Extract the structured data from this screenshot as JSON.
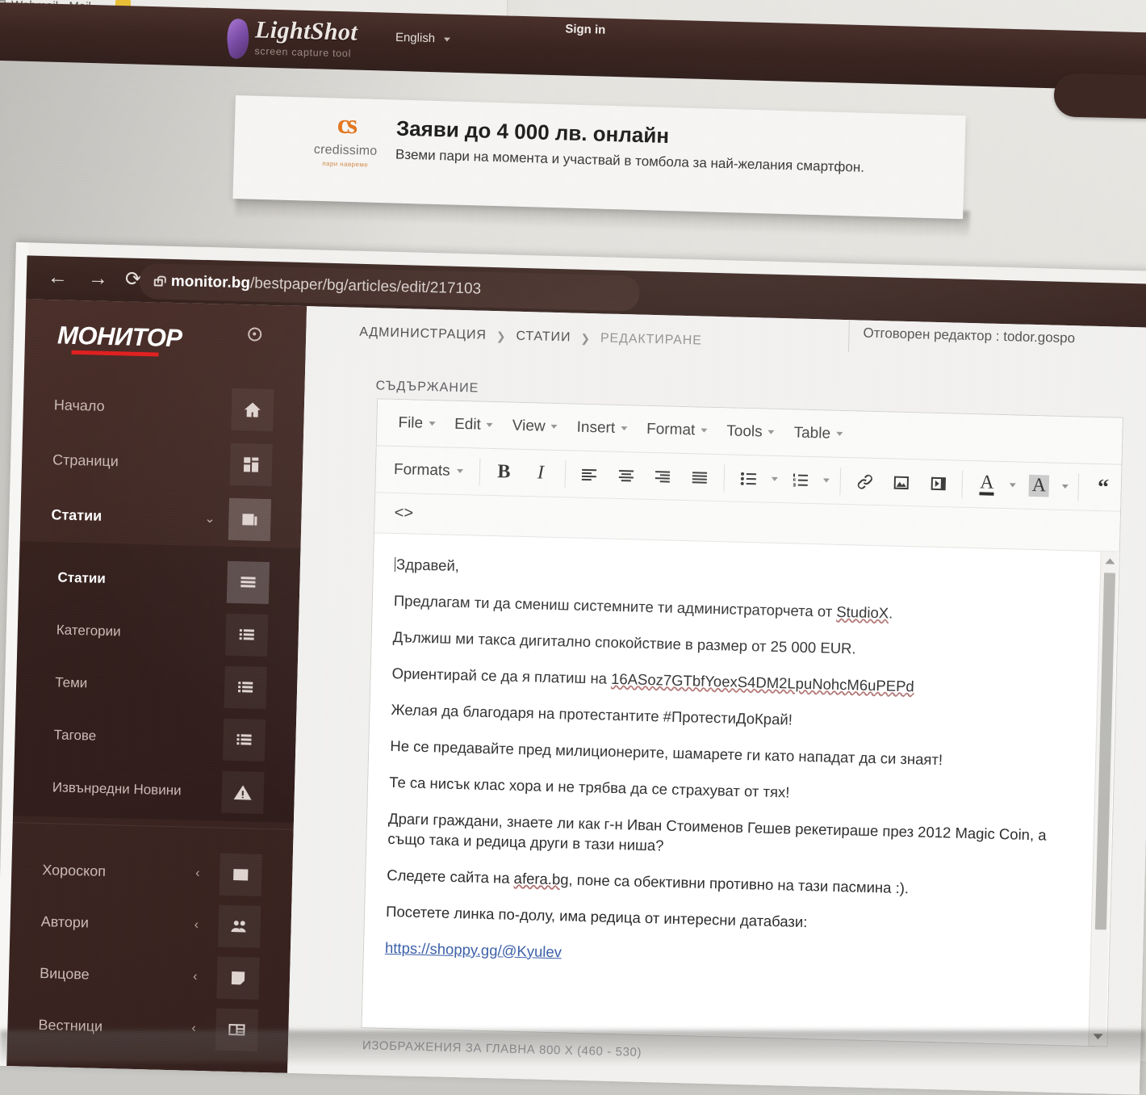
{
  "browser_tab": {
    "title": "Webmail - Mail",
    "favicon": "document-icon"
  },
  "lightshot_header": {
    "brand": "LightShot",
    "tagline": "screen capture tool",
    "language": "English",
    "sign_in": "Sign in",
    "pill_glyph": "O",
    "bar_color": "#3a2420"
  },
  "ad": {
    "logo_mark": "cs",
    "brand": "credissimo",
    "brand_sub": "пари навреме",
    "headline": "Заяви до 4 000 лв. онлайн",
    "subline": "Вземи пари на момента и участвай в томбола за най-желания смартфон.",
    "accent_color": "#e2761f"
  },
  "chrome": {
    "back_icon": "←",
    "forward_icon": "→",
    "reload_icon": "⟳",
    "lock_icon": "lock-icon",
    "url_domain": "monitor.bg",
    "url_path": "/bestpaper/bg/articles/edit/217103"
  },
  "sidebar": {
    "logo": "МОНИТОР",
    "logo_rule_color": "#e02020",
    "gear_icon": "gear-icon",
    "items": [
      {
        "label": "Начало",
        "icon": "home-icon",
        "level": 1,
        "chevron": "",
        "active": false
      },
      {
        "label": "Страници",
        "icon": "layout-icon",
        "level": 1,
        "chevron": "",
        "active": false
      },
      {
        "label": "Статии",
        "icon": "news-icon",
        "level": 1,
        "chevron": "⌄",
        "active": true
      },
      {
        "label": "Статии",
        "icon": "list-icon",
        "level": 2,
        "chevron": "",
        "active": true
      },
      {
        "label": "Категории",
        "icon": "list-icon",
        "level": 2,
        "chevron": "",
        "active": false
      },
      {
        "label": "Теми",
        "icon": "list-icon",
        "level": 2,
        "chevron": "",
        "active": false
      },
      {
        "label": "Тагове",
        "icon": "list-icon",
        "level": 2,
        "chevron": "",
        "active": false
      },
      {
        "label": "Извънредни Новини",
        "icon": "alert-icon",
        "level": 2,
        "chevron": "",
        "active": false
      },
      {
        "label": "Хороскоп",
        "icon": "card-icon",
        "level": 1,
        "chevron": "‹",
        "active": false
      },
      {
        "label": "Автори",
        "icon": "users-icon",
        "level": 1,
        "chevron": "‹",
        "active": false
      },
      {
        "label": "Вицове",
        "icon": "note-icon",
        "level": 1,
        "chevron": "‹",
        "active": false
      },
      {
        "label": "Вестници",
        "icon": "paper-icon",
        "level": 1,
        "chevron": "‹",
        "active": false
      }
    ]
  },
  "topbar": {
    "breadcrumb": [
      "АДМИНИСТРАЦИЯ",
      "СТАТИИ",
      "РЕДАКТИРАНЕ"
    ],
    "separator": "❯",
    "editor_in_charge": "Отговорен редактор : todor.gospo"
  },
  "form": {
    "content_label": "СЪДЪРЖАНИЕ",
    "below_label": "ИЗОБРАЖЕНИЯ ЗА ГЛАВНА 800 X (460 - 530)"
  },
  "editor": {
    "menus": [
      "File",
      "Edit",
      "View",
      "Insert",
      "Format",
      "Tools",
      "Table"
    ],
    "formats_label": "Formats",
    "toolbar_buttons": [
      "bold-button",
      "italic-button",
      "align-left-button",
      "align-center-button",
      "align-right-button",
      "align-justify-button",
      "bullet-list-button",
      "numbered-list-button",
      "link-button",
      "image-button",
      "media-button",
      "text-color-button",
      "background-color-button",
      "blockquote-button"
    ],
    "source_code_button": "<>",
    "scrollbar": {
      "up_arrow": "▲",
      "down_arrow": "▼",
      "thumb_position_pct": 4,
      "thumb_size_pct": 72
    },
    "content": [
      {
        "text": "Здравей,",
        "caret": true
      },
      {
        "pre": "Предлагам ти да смениш системните ти администраторчета от ",
        "spell": "StudioX",
        "post": "."
      },
      {
        "text": "Дължиш ми такса дигитално спокойствие в размер от 25 000 EUR."
      },
      {
        "pre": "Ориентирай се да я платиш на ",
        "spell": "16ASoz7GTbfYoexS4DM2LpuNohcM6uPEPd",
        "post": ""
      },
      {
        "text": "Желая да благодаря на протестантите #ПротестиДоКрай!"
      },
      {
        "text": "Не се предавайте пред милиционерите, шамарете ги като нападат да си знаят!"
      },
      {
        "text": "Те са нисък клас хора и не трябва да се страхуват от тях!"
      },
      {
        "text": "Драги граждани, знаете ли как г-н Иван Стоименов Гешев рекетираше през 2012 Magic Coin, а също така и редица други в тази ниша?"
      },
      {
        "pre": "Следете сайта на ",
        "spell": "afera.bg",
        "post": ", поне са обективни противно на тази пасмина :)."
      },
      {
        "text": "Посетете линка по-долу, има редица от интересни датабази:"
      },
      {
        "link": "https://shoppy.gg/@Kyulev"
      }
    ]
  }
}
